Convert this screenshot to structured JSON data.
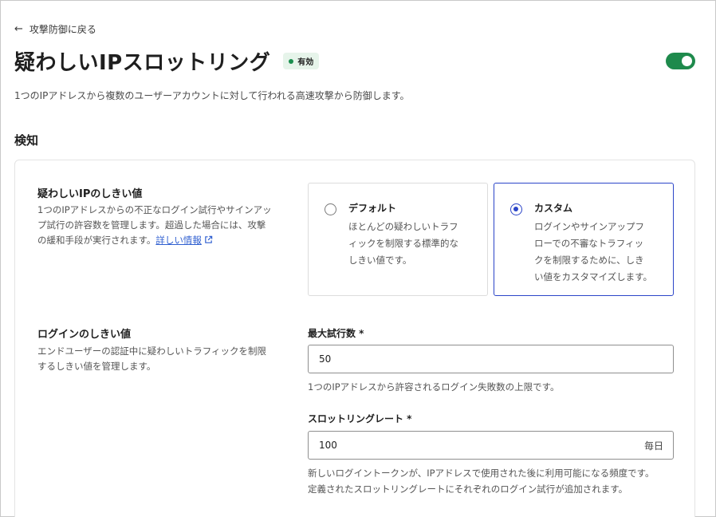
{
  "back_link": {
    "label": "攻撃防御に戻る",
    "icon": "arrow-left-icon"
  },
  "header": {
    "title": "疑わしいIPスロットリング",
    "status_badge": "有効",
    "toggle_state": "on",
    "description": "1つのIPアドレスから複数のユーザーアカウントに対して行われる高速攻撃から防御します。"
  },
  "section": {
    "title": "検知"
  },
  "threshold": {
    "label": "疑わしいIPのしきい値",
    "desc_lines": [
      "1つのIPアドレスからの不正なログイン試行やサインアッ",
      "プ試行の許容数を管理します。超過した場合には、攻撃",
      "の緩和手段が実行されます。"
    ],
    "link_text": "詳しい情報",
    "options": [
      {
        "title": "デフォルト",
        "selected": false,
        "desc_lines": [
          "ほとんどの疑わしいトラフ",
          "ィックを制限する標準的な",
          "しきい値です。"
        ]
      },
      {
        "title": "カスタム",
        "selected": true,
        "desc_lines": [
          "ログインやサインアップフ",
          "ローでの不審なトラフィッ",
          "クを制限するために、しき",
          "い値をカスタマイズします。"
        ]
      }
    ]
  },
  "login_threshold": {
    "label": "ログインのしきい値",
    "desc_lines": [
      "エンドユーザーの認証中に疑わしいトラフィックを制限",
      "するしきい値を管理します。"
    ],
    "max_attempts": {
      "label": "最大試行数 *",
      "value": "50",
      "helper": "1つのIPアドレスから許容されるログイン失敗数の上限です。"
    },
    "throttling_rate": {
      "label": "スロットリングレート *",
      "value": "100",
      "suffix": "毎日",
      "helper_lines": [
        "新しいログイントークンが、IPアドレスで使用された後に利用可能になる頻度です。",
        "定義されたスロットリングレートにそれぞれのログイン試行が追加されます。"
      ]
    }
  },
  "colors": {
    "accent": "#2b45c8",
    "toggle_on": "#1e8a4c",
    "badge_bg": "#e6f4ea",
    "link": "#2f5fd0"
  }
}
